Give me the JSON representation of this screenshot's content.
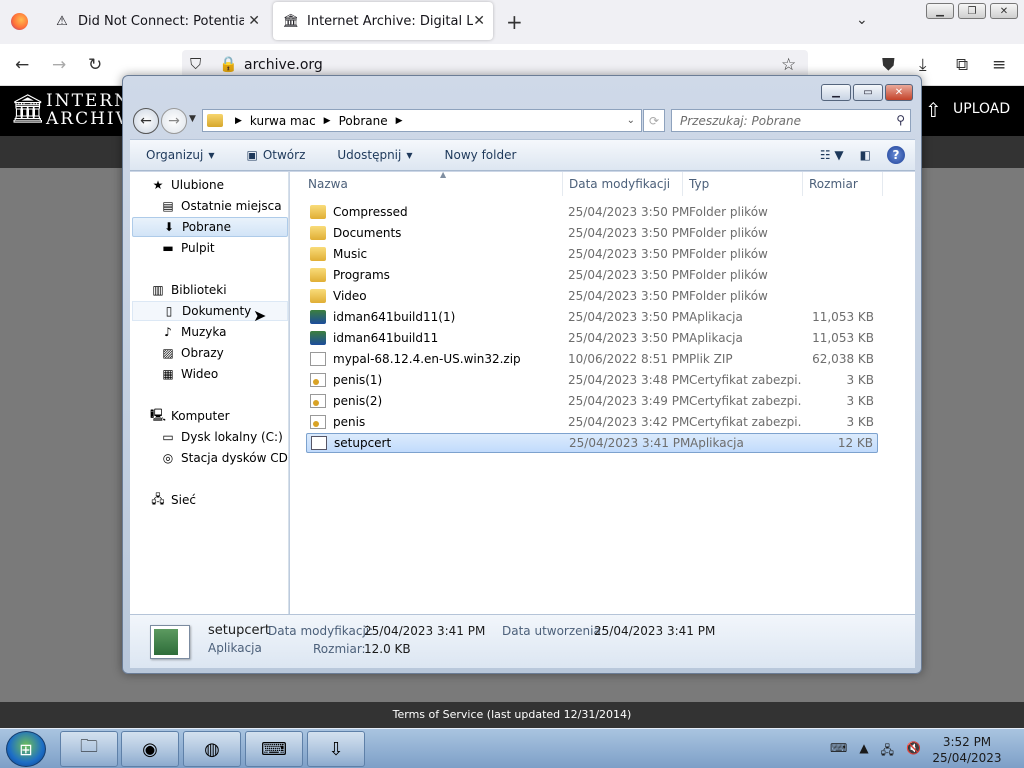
{
  "browser": {
    "tabs": [
      {
        "label": "Did Not Connect: Potential Security Issue",
        "icon": "warning-icon",
        "active": false
      },
      {
        "label": "Internet Archive: Digital Library of Free & Borrowable Books",
        "icon": "archive-icon",
        "active": true
      }
    ],
    "url": "archive.org",
    "new_tab_label": "+"
  },
  "archive_page": {
    "name_line1": "INTERNET",
    "name_line2": "ARCHIVE",
    "upload_label": "UPLOAD",
    "footer_text": "Terms of Service (last updated 12/31/2014)"
  },
  "explorer": {
    "breadcrumb": [
      "kurwa mac",
      "Pobrane"
    ],
    "search_placeholder": "Przeszukaj: Pobrane",
    "commands": {
      "organize": "Organizuj",
      "open": "Otwórz",
      "share": "Udostępnij",
      "new_folder": "Nowy folder"
    },
    "nav": {
      "favorites_header": "Ulubione",
      "favorites": [
        "Ostatnie miejsca",
        "Pobrane",
        "Pulpit"
      ],
      "libraries_header": "Biblioteki",
      "libraries": [
        "Dokumenty",
        "Muzyka",
        "Obrazy",
        "Wideo"
      ],
      "computer_header": "Komputer",
      "drives": [
        "Dysk lokalny (C:)",
        "Stacja dysków CD (D"
      ],
      "network_header": "Sieć"
    },
    "columns": [
      "Nazwa",
      "Data modyfikacji",
      "Typ",
      "Rozmiar"
    ],
    "files": [
      {
        "name": "Compressed",
        "date": "25/04/2023 3:50 PM",
        "type": "Folder plików",
        "size": "",
        "icon": "folder-icon"
      },
      {
        "name": "Documents",
        "date": "25/04/2023 3:50 PM",
        "type": "Folder plików",
        "size": "",
        "icon": "folder-icon"
      },
      {
        "name": "Music",
        "date": "25/04/2023 3:50 PM",
        "type": "Folder plików",
        "size": "",
        "icon": "folder-icon"
      },
      {
        "name": "Programs",
        "date": "25/04/2023 3:50 PM",
        "type": "Folder plików",
        "size": "",
        "icon": "folder-icon"
      },
      {
        "name": "Video",
        "date": "25/04/2023 3:50 PM",
        "type": "Folder plików",
        "size": "",
        "icon": "folder-icon"
      },
      {
        "name": "idman641build11(1)",
        "date": "25/04/2023 3:50 PM",
        "type": "Aplikacja",
        "size": "11,053 KB",
        "icon": "installer-icon"
      },
      {
        "name": "idman641build11",
        "date": "25/04/2023 3:50 PM",
        "type": "Aplikacja",
        "size": "11,053 KB",
        "icon": "installer-icon"
      },
      {
        "name": "mypal-68.12.4.en-US.win32.zip",
        "date": "10/06/2022 8:51 PM",
        "type": "Plik ZIP",
        "size": "62,038 KB",
        "icon": "zip-icon"
      },
      {
        "name": "penis(1)",
        "date": "25/04/2023 3:48 PM",
        "type": "Certyfikat zabezpi...",
        "size": "3 KB",
        "icon": "certificate-icon"
      },
      {
        "name": "penis(2)",
        "date": "25/04/2023 3:49 PM",
        "type": "Certyfikat zabezpi...",
        "size": "3 KB",
        "icon": "certificate-icon"
      },
      {
        "name": "penis",
        "date": "25/04/2023 3:42 PM",
        "type": "Certyfikat zabezpi...",
        "size": "3 KB",
        "icon": "certificate-icon"
      },
      {
        "name": "setupcert",
        "date": "25/04/2023 3:41 PM",
        "type": "Aplikacja",
        "size": "12 KB",
        "icon": "application-icon",
        "selected": true
      }
    ],
    "details": {
      "name": "setupcert",
      "type": "Aplikacja",
      "modified_label": "Data modyfikacji:",
      "modified_value": "25/04/2023 3:41 PM",
      "created_label": "Data utworzenia:",
      "created_value": "25/04/2023 3:41 PM",
      "size_label": "Rozmiar:",
      "size_value": "12.0 KB"
    }
  },
  "taskbar": {
    "time": "3:52 PM",
    "date": "25/04/2023"
  }
}
